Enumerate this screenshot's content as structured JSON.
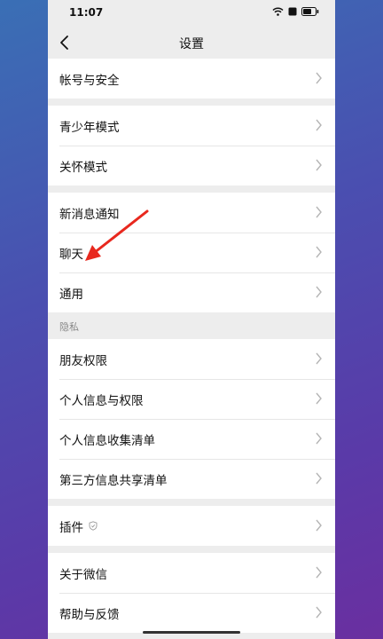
{
  "status_bar": {
    "time": "11:07"
  },
  "nav": {
    "title": "设置"
  },
  "groups": [
    {
      "items": [
        {
          "label": "帐号与安全"
        }
      ]
    },
    {
      "items": [
        {
          "label": "青少年模式"
        },
        {
          "label": "关怀模式"
        }
      ]
    },
    {
      "items": [
        {
          "label": "新消息通知"
        },
        {
          "label": "聊天"
        },
        {
          "label": "通用"
        }
      ]
    },
    {
      "header": "隐私",
      "items": [
        {
          "label": "朋友权限"
        },
        {
          "label": "个人信息与权限"
        },
        {
          "label": "个人信息收集清单"
        },
        {
          "label": "第三方信息共享清单"
        }
      ]
    },
    {
      "items": [
        {
          "label": "插件"
        }
      ]
    },
    {
      "items": [
        {
          "label": "关于微信"
        },
        {
          "label": "帮助与反馈"
        }
      ]
    }
  ],
  "colors": {
    "annotation_arrow": "#e8281e"
  }
}
